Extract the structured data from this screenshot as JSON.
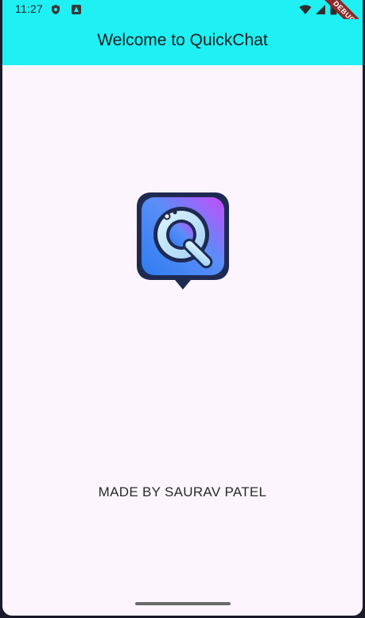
{
  "status_bar": {
    "time": "11:27",
    "icons": [
      "shield-icon",
      "android-icon",
      "wifi-icon",
      "signal-icon",
      "battery-icon"
    ]
  },
  "app_bar": {
    "title": "Welcome to QuickChat"
  },
  "logo": {
    "icon": "quickchat-logo-icon",
    "letter": "Q"
  },
  "footer": {
    "credit": "MADE BY SAURAV PATEL"
  },
  "debug_banner": {
    "label": "DEBUG"
  },
  "colors": {
    "app_bar": "#1ff0f4",
    "background": "#fcf5fd",
    "logo_gradient_start": "#3b8cf6",
    "logo_gradient_end": "#c44dfa",
    "logo_border": "#1e2a52"
  }
}
